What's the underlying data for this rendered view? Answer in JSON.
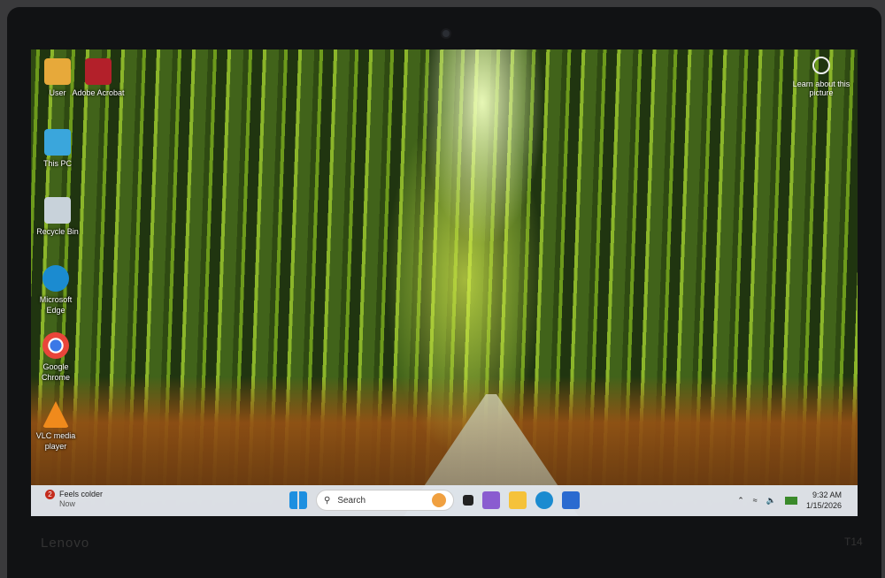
{
  "device": {
    "brand": "Lenovo",
    "model": "T14"
  },
  "desktop": {
    "learn_about": "Learn about this picture",
    "icons": [
      {
        "label": "User",
        "icon": "user-folder-icon",
        "color": "#e7a93a"
      },
      {
        "label": "Adobe Acrobat",
        "icon": "adobe-acrobat-icon",
        "color": "#b3202a"
      },
      {
        "label": "This PC",
        "icon": "monitor-icon",
        "color": "#3aa6dc"
      },
      {
        "label": "Recycle Bin",
        "icon": "recycle-bin-icon",
        "color": "#c8d2da"
      },
      {
        "label": "Microsoft Edge",
        "icon": "edge-icon",
        "color": "#1b8bd0"
      },
      {
        "label": "Google Chrome",
        "icon": "chrome-icon",
        "color": "#e9453a"
      },
      {
        "label": "VLC media player",
        "icon": "vlc-icon",
        "color": "#f08a1c"
      }
    ]
  },
  "taskbar": {
    "weather": {
      "badge": "2",
      "title": "Feels colder",
      "subtitle": "Now"
    },
    "search_placeholder": "Search",
    "apps": [
      {
        "name": "widgets",
        "color": "#f0a040"
      },
      {
        "name": "task-view",
        "color": "#222222"
      },
      {
        "name": "microsoft-365",
        "color": "#8a5cd0"
      },
      {
        "name": "file-explorer",
        "color": "#f5c23a"
      },
      {
        "name": "edge",
        "color": "#1b8bd0"
      },
      {
        "name": "microsoft-store",
        "color": "#2a6ad0"
      }
    ],
    "time": "9:32 AM",
    "date": "1/15/2026"
  }
}
